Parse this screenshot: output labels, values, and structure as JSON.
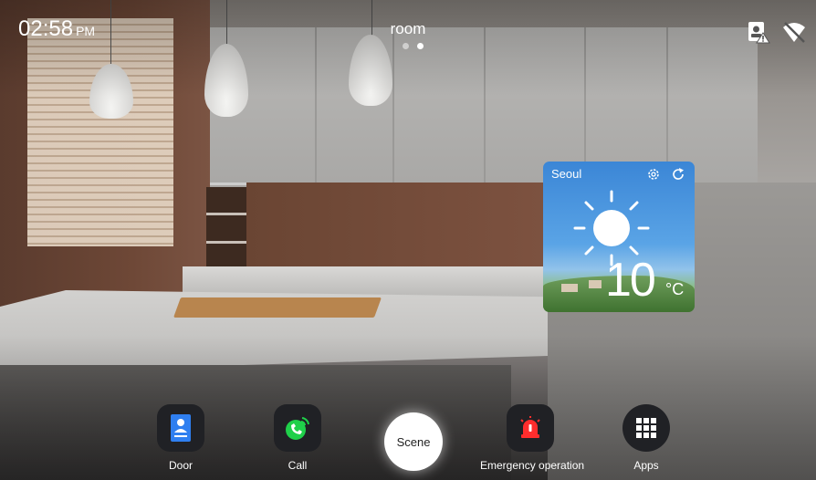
{
  "status_bar": {
    "time": "02:58",
    "ampm": "PM",
    "page_title": "room",
    "pages": 2,
    "active_page": 2,
    "icons": [
      "card-reader-alert-icon",
      "wifi-off-icon"
    ]
  },
  "weather": {
    "city": "Seoul",
    "temperature": "10",
    "unit": "°C",
    "condition_icon": "sun-icon",
    "settings_icon": "gear-icon",
    "refresh_icon": "refresh-icon"
  },
  "dock": {
    "door_label": "Door",
    "call_label": "Call",
    "scene_label": "Scene",
    "emergency_label": "Emergency operation",
    "apps_label": "Apps"
  },
  "colors": {
    "call_green": "#1fd04a",
    "door_blue": "#2f7ff0",
    "emergency_red": "#ff2d2d",
    "dock_bg": "#202125"
  }
}
